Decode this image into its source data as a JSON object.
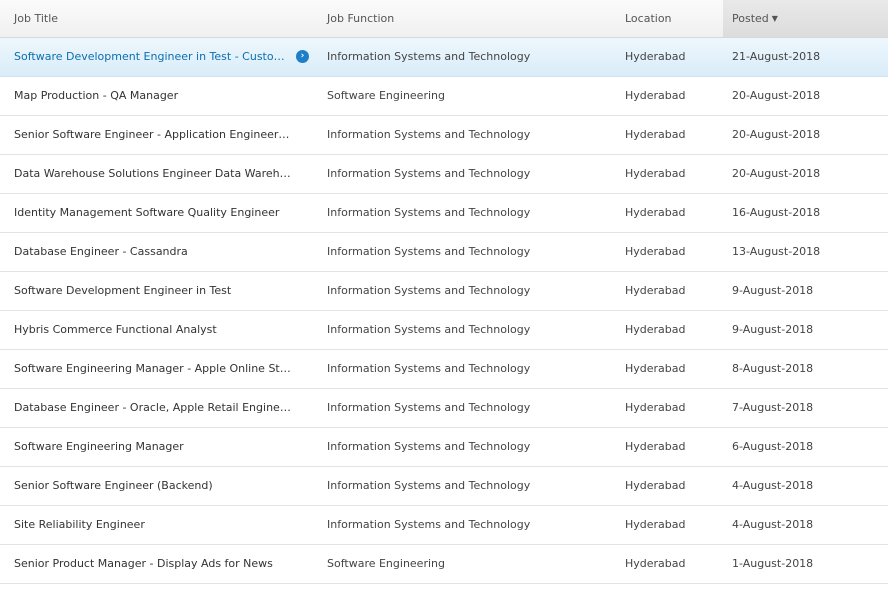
{
  "table": {
    "columns": {
      "title": "Job Title",
      "function": "Job Function",
      "location": "Location",
      "posted": "Posted"
    },
    "sort_indicator": "▼",
    "row_open_icon": "›",
    "rows": [
      {
        "title": "Software Development Engineer in Test - Custom...",
        "function": "Information Systems and Technology",
        "location": "Hyderabad",
        "posted": "21-August-2018",
        "selected": true
      },
      {
        "title": "Map Production - QA Manager",
        "function": "Software Engineering",
        "location": "Hyderabad",
        "posted": "20-August-2018"
      },
      {
        "title": "Senior Software Engineer - Application Engineering",
        "function": "Information Systems and Technology",
        "location": "Hyderabad",
        "posted": "20-August-2018"
      },
      {
        "title": "Data Warehouse Solutions Engineer Data Wareho...",
        "function": "Information Systems and Technology",
        "location": "Hyderabad",
        "posted": "20-August-2018"
      },
      {
        "title": "Identity Management Software Quality Engineer",
        "function": "Information Systems and Technology",
        "location": "Hyderabad",
        "posted": "16-August-2018"
      },
      {
        "title": "Database Engineer - Cassandra",
        "function": "Information Systems and Technology",
        "location": "Hyderabad",
        "posted": "13-August-2018"
      },
      {
        "title": "Software Development Engineer in Test",
        "function": "Information Systems and Technology",
        "location": "Hyderabad",
        "posted": "9-August-2018"
      },
      {
        "title": "Hybris Commerce Functional Analyst",
        "function": "Information Systems and Technology",
        "location": "Hyderabad",
        "posted": "9-August-2018"
      },
      {
        "title": "Software Engineering Manager - Apple Online Store",
        "function": "Information Systems and Technology",
        "location": "Hyderabad",
        "posted": "8-August-2018"
      },
      {
        "title": "Database Engineer - Oracle, Apple Retail Enginee...",
        "function": "Information Systems and Technology",
        "location": "Hyderabad",
        "posted": "7-August-2018"
      },
      {
        "title": "Software Engineering Manager",
        "function": "Information Systems and Technology",
        "location": "Hyderabad",
        "posted": "6-August-2018"
      },
      {
        "title": "Senior Software Engineer (Backend)",
        "function": "Information Systems and Technology",
        "location": "Hyderabad",
        "posted": "4-August-2018"
      },
      {
        "title": "Site Reliability Engineer",
        "function": "Information Systems and Technology",
        "location": "Hyderabad",
        "posted": "4-August-2018"
      },
      {
        "title": "Senior Product Manager - Display Ads for News",
        "function": "Software Engineering",
        "location": "Hyderabad",
        "posted": "1-August-2018"
      }
    ]
  }
}
